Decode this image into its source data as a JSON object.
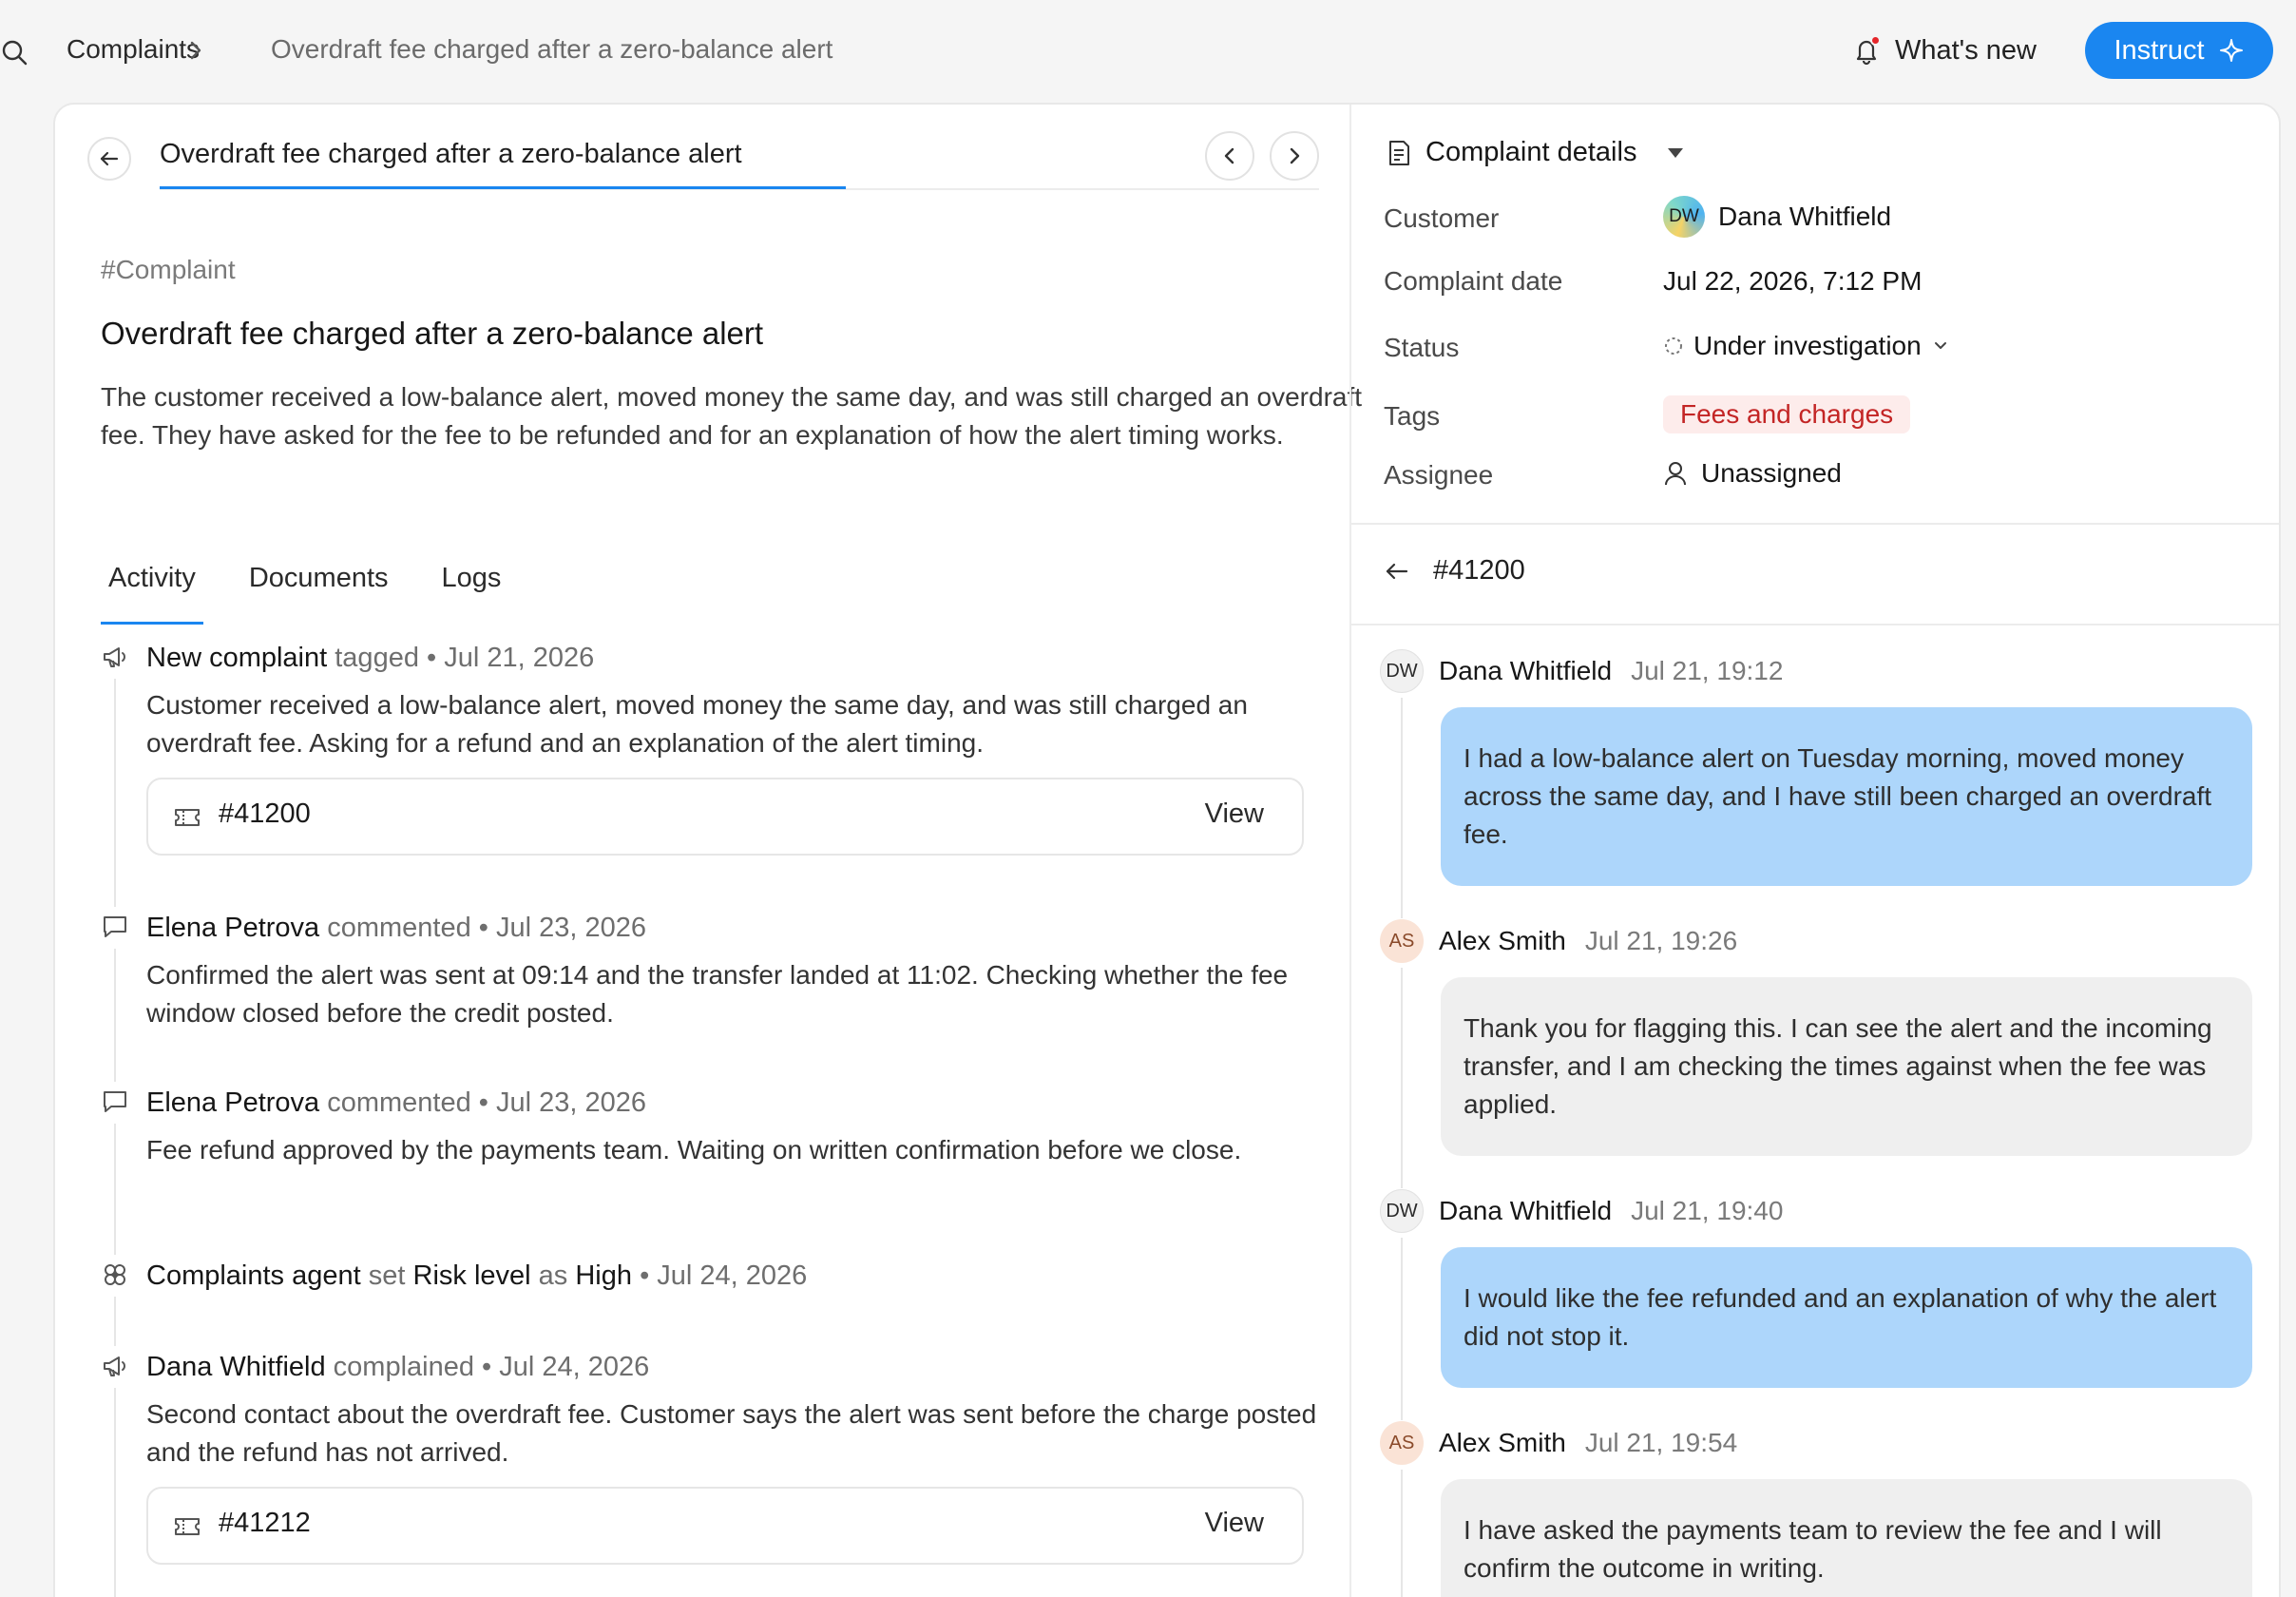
{
  "breadcrumb": {
    "root": "Complaints",
    "current": "Overdraft fee charged after a zero-balance alert"
  },
  "topbar": {
    "whats_new": "What's new",
    "instruct": "Instruct"
  },
  "document": {
    "tab_title": "Overdraft fee charged after a zero-balance alert",
    "hashtag": "#Complaint",
    "title": "Overdraft fee charged after a zero-balance alert",
    "description": "The customer received a low-balance alert, moved money the same day, and was still charged an overdraft fee. They have asked for the fee to be refunded and for an explanation of how the alert timing works."
  },
  "tabs": [
    "Activity",
    "Documents",
    "Logs"
  ],
  "activity": [
    {
      "icon": "megaphone-icon",
      "actor": "New complaint",
      "verb": "tagged",
      "date": "Jul 21, 2026",
      "body": "Customer received a low-balance alert, moved money the same day, and was still charged an overdraft fee. Asking for a refund and an explanation of the alert timing.",
      "attachment": {
        "id": "#41200",
        "action": "View"
      }
    },
    {
      "icon": "comment-icon",
      "actor": "Elena Petrova",
      "verb": "commented",
      "date": "Jul 23, 2026",
      "body": "Confirmed the alert was sent at 09:14 and the transfer landed at 11:02. Checking whether the fee window closed before the credit posted."
    },
    {
      "icon": "comment-icon",
      "actor": "Elena Petrova",
      "verb": "commented",
      "date": "Jul 23, 2026",
      "body": "Fee refund approved by the payments team. Waiting on written confirmation before we close."
    },
    {
      "icon": "agent-icon",
      "actor": "Complaints agent",
      "verb": "set",
      "field": "Risk level",
      "connector": "as",
      "value": "High",
      "date": "Jul 24, 2026"
    },
    {
      "icon": "megaphone-icon",
      "actor": "Dana Whitfield",
      "verb": "complained",
      "date": "Jul 24, 2026",
      "body": "Second contact about the overdraft fee. Customer says the alert was sent before the charge posted and the refund has not arrived.",
      "attachment": {
        "id": "#41212",
        "action": "View"
      }
    }
  ],
  "details": {
    "header": "Complaint details",
    "labels": {
      "customer": "Customer",
      "date": "Complaint date",
      "status": "Status",
      "tags": "Tags",
      "assignee": "Assignee"
    },
    "customer_initials": "DW",
    "customer_name": "Dana Whitfield",
    "date": "Jul 22, 2026, 7:12 PM",
    "status": "Under investigation",
    "tag": "Fees and charges",
    "assignee": "Unassigned",
    "tag_color": "#c32525"
  },
  "thread": {
    "id": "#41200",
    "messages": [
      {
        "initials": "DW",
        "name": "Dana Whitfield",
        "time": "Jul 21, 19:12",
        "from": "customer",
        "text": "I had a low-balance alert on Tuesday morning, moved money across the same day, and I have still been charged an overdraft fee."
      },
      {
        "initials": "AS",
        "name": "Alex Smith",
        "time": "Jul 21, 19:26",
        "from": "agent",
        "text": "Thank you for flagging this. I can see the alert and the incoming transfer, and I am checking the times against when the fee was applied."
      },
      {
        "initials": "DW",
        "name": "Dana Whitfield",
        "time": "Jul 21, 19:40",
        "from": "customer",
        "text": "I would like the fee refunded and an explanation of why the alert did not stop it."
      },
      {
        "initials": "AS",
        "name": "Alex Smith",
        "time": "Jul 21, 19:54",
        "from": "agent",
        "text": "I have asked the payments team to review the fee and I will confirm the outcome in writing."
      }
    ]
  },
  "colors": {
    "accent": "#1a86f0",
    "customer_bubble": "#add6fb",
    "agent_bubble": "#efefef"
  }
}
